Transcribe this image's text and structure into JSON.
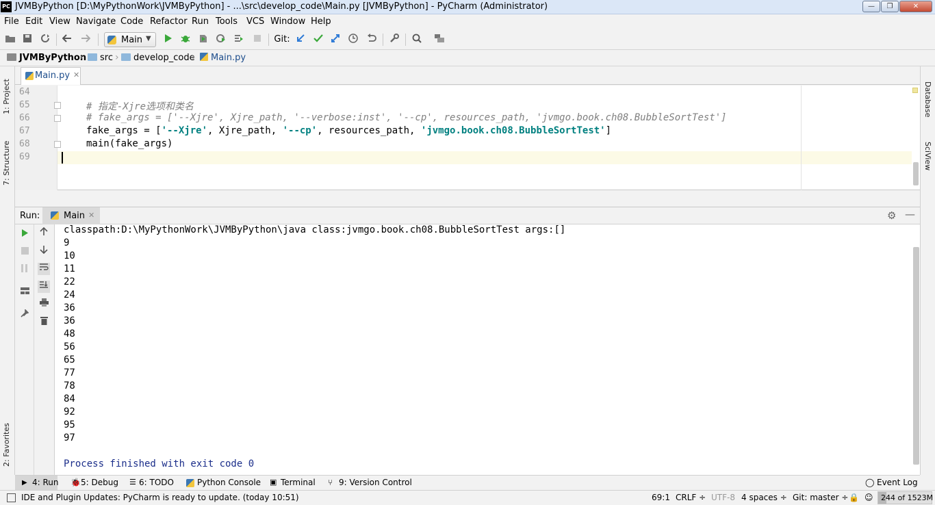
{
  "window": {
    "app_icon": "PC",
    "title": "JVMByPython [D:\\MyPythonWork\\JVMByPython] - ...\\src\\develop_code\\Main.py [JVMByPython] - PyCharm (Administrator)",
    "min": "—",
    "max": "❐",
    "close": "✕"
  },
  "menu": [
    "File",
    "Edit",
    "View",
    "Navigate",
    "Code",
    "Refactor",
    "Run",
    "Tools",
    "VCS",
    "Window",
    "Help"
  ],
  "toolbar": {
    "run_config": "Main",
    "git_label": "Git:"
  },
  "breadcrumbs": {
    "project": "JVMByPython",
    "items": [
      "src",
      "develop_code",
      "Main.py"
    ]
  },
  "left_strip": {
    "project": "1: Project",
    "structure": "7: Structure",
    "favorites": "2: Favorites"
  },
  "right_strip": {
    "database": "Database",
    "sciview": "SciView"
  },
  "editor": {
    "tab": "Main.py",
    "line_numbers": [
      "64",
      "65",
      "66",
      "67",
      "68",
      "69"
    ],
    "lines": [
      {
        "parts": [
          {
            "t": "",
            "c": ""
          }
        ]
      },
      {
        "parts": [
          {
            "t": "# 指定-Xjre选项和类名",
            "c": "cmt"
          }
        ]
      },
      {
        "parts": [
          {
            "t": "# fake_args = ['--Xjre', Xjre_path, '--verbose:inst', '--cp', resources_path, 'jvmgo.book.ch08.BubbleSortTest']",
            "c": "cmt"
          }
        ]
      },
      {
        "parts": [
          {
            "t": "fake_args = [",
            "c": ""
          },
          {
            "t": "'--Xjre'",
            "c": "str"
          },
          {
            "t": ", Xjre_path, ",
            "c": ""
          },
          {
            "t": "'--cp'",
            "c": "str"
          },
          {
            "t": ", resources_path, ",
            "c": ""
          },
          {
            "t": "'jvmgo.book.ch08.BubbleSortTest'",
            "c": "str"
          },
          {
            "t": "]",
            "c": ""
          }
        ]
      },
      {
        "parts": [
          {
            "t": "main(fake_args)",
            "c": ""
          }
        ]
      },
      {
        "parts": [
          {
            "t": "",
            "c": ""
          }
        ]
      }
    ]
  },
  "run_panel": {
    "label": "Run:",
    "tab": "Main",
    "output": [
      "classpath:D:\\MyPythonWork\\JVMByPython\\java class:jvmgo.book.ch08.BubbleSortTest args:[]",
      "9",
      "10",
      "11",
      "22",
      "24",
      "36",
      "36",
      "48",
      "56",
      "65",
      "77",
      "78",
      "84",
      "92",
      "95",
      "97",
      "",
      "Process finished with exit code 0"
    ]
  },
  "tool_tabs": {
    "run": "4: Run",
    "debug": "5: Debug",
    "todo": "6: TODO",
    "python_console": "Python Console",
    "terminal": "Terminal",
    "vcs": "9: Version Control",
    "event_log": "Event Log"
  },
  "status": {
    "message": "IDE and Plugin Updates: PyCharm is ready to update. (today 10:51)",
    "position": "69:1",
    "line_sep": "CRLF ÷",
    "encoding": "UTF-8",
    "indent": "4 spaces ÷",
    "branch": "Git: master ÷",
    "memory": "244 of 1523M",
    "memory_fraction": 0.16
  }
}
